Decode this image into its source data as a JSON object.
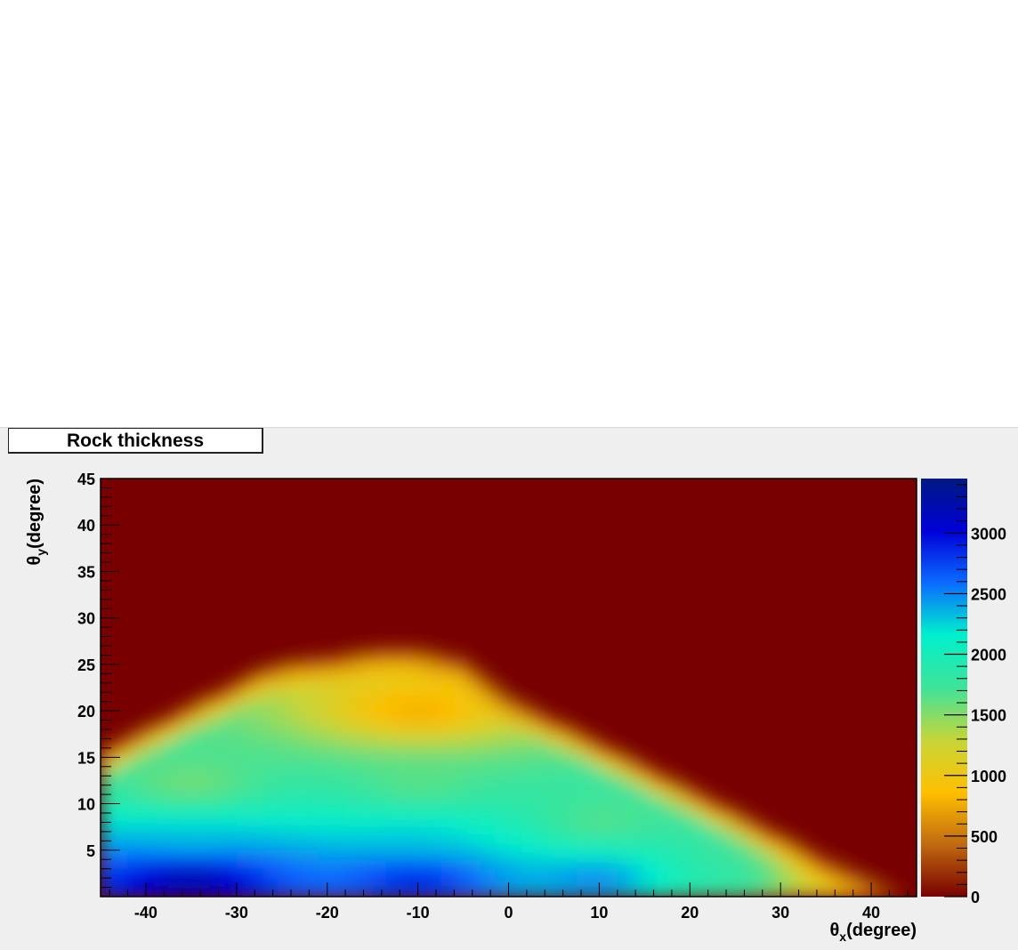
{
  "chart_data": {
    "type": "heatmap",
    "title": "Rock thickness",
    "xlabel_symbol": "θ",
    "xlabel_sub": "x",
    "xlabel_rest": "(degree)",
    "ylabel_symbol": "θ",
    "ylabel_sub": "y",
    "ylabel_rest": "(degree)",
    "xlim": [
      -45,
      45
    ],
    "ylim": [
      0,
      45
    ],
    "x_ticks": [
      -40,
      -30,
      -20,
      -10,
      0,
      10,
      20,
      30,
      40
    ],
    "y_ticks": [
      5,
      10,
      15,
      20,
      25,
      30,
      35,
      40,
      45
    ],
    "z_range": [
      0,
      3450
    ],
    "z_ticks": [
      0,
      500,
      1000,
      1500,
      2000,
      2500,
      3000
    ],
    "colormap": [
      "#780000",
      "#c06a10",
      "#ffc000",
      "#c6d53a",
      "#3fe39a",
      "#00f0cc",
      "#0a6cff",
      "#0000d8",
      "#001a80"
    ],
    "background_value": 0,
    "surface_profile": {
      "theta_x": [
        -45,
        -40,
        -35,
        -30,
        -27,
        -25,
        -22,
        -18,
        -15,
        -12,
        -10,
        -5,
        0,
        5,
        10,
        15,
        20,
        25,
        30,
        35,
        40,
        45
      ],
      "theta_y_top": [
        16,
        18.5,
        21,
        23.5,
        25,
        25.5,
        26,
        26.5,
        27,
        27.2,
        27,
        26,
        22,
        19.5,
        17,
        14.5,
        12,
        9.5,
        7,
        4.5,
        2.5,
        0
      ]
    },
    "thickness_samples": [
      {
        "theta_x": -35,
        "theta_y": 2,
        "value": 3400
      },
      {
        "theta_x": -35,
        "theta_y": 6,
        "value": 2300
      },
      {
        "theta_x": -35,
        "theta_y": 12,
        "value": 1500
      },
      {
        "theta_x": -10,
        "theta_y": 2,
        "value": 3000
      },
      {
        "theta_x": -10,
        "theta_y": 6,
        "value": 2300
      },
      {
        "theta_x": -10,
        "theta_y": 12,
        "value": 1600
      },
      {
        "theta_x": -10,
        "theta_y": 20,
        "value": 700
      },
      {
        "theta_x": 10,
        "theta_y": 2,
        "value": 2600
      },
      {
        "theta_x": 10,
        "theta_y": 8,
        "value": 1600
      },
      {
        "theta_x": 25,
        "theta_y": 2,
        "value": 1900
      },
      {
        "theta_x": 35,
        "theta_y": 2,
        "value": 1100
      },
      {
        "theta_x": 42,
        "theta_y": 2,
        "value": 500
      }
    ]
  }
}
